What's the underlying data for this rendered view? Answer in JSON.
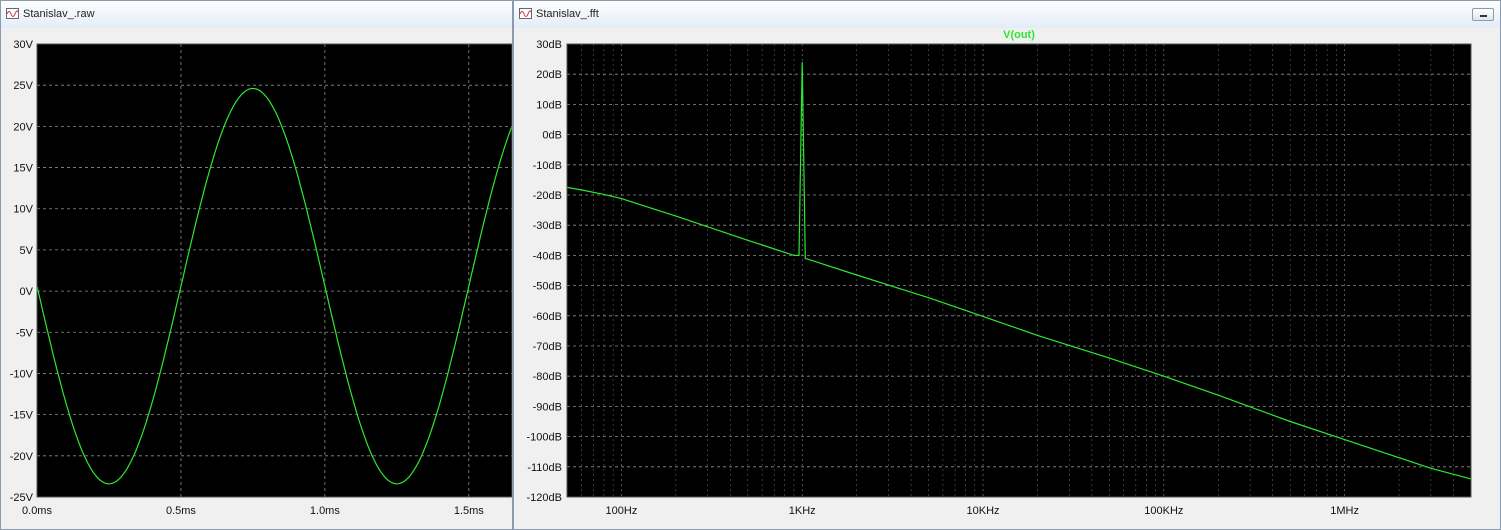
{
  "windows": {
    "raw": {
      "title": "Stanislav_.raw"
    },
    "fft": {
      "title": "Stanislav_.fft"
    }
  },
  "colors": {
    "trace": "#2ee82e",
    "title": "#2ee82e",
    "plot_bg": "#000000",
    "grid": "#8c8c8c"
  },
  "icons": {
    "app": "waveform-icon",
    "minimize": "minimize-icon"
  },
  "chart_data": [
    {
      "type": "line",
      "title": "",
      "xlabel": "",
      "ylabel": "",
      "xlim": [
        0.0,
        1.65
      ],
      "ylim": [
        -25,
        30
      ],
      "x_unit": "ms",
      "y_unit": "V",
      "xticks": [
        0.0,
        0.5,
        1.0,
        1.5
      ],
      "xtick_labels": [
        "0.0ms",
        "0.5ms",
        "1.0ms",
        "1.5ms"
      ],
      "yticks": [
        30,
        25,
        20,
        15,
        10,
        5,
        0,
        -5,
        -10,
        -15,
        -20,
        -25
      ],
      "ytick_labels": [
        "30V",
        "25V",
        "20V",
        "15V",
        "10V",
        "5V",
        "0V",
        "-5V",
        "-10V",
        "-15V",
        "-20V",
        "-25V"
      ],
      "grid": true,
      "series": [
        {
          "name": "",
          "amplitude": 24,
          "offset": 0.6,
          "frequency_hz": 1000,
          "phase": "inverted sine",
          "x": [
            0.0,
            0.25,
            0.5,
            0.75,
            1.0,
            1.25,
            1.5,
            1.65
          ],
          "y": [
            0.6,
            -23.4,
            0.6,
            24.6,
            0.6,
            -23.4,
            0.6,
            22.0
          ]
        }
      ]
    },
    {
      "type": "line",
      "title": "V(out)",
      "xlabel": "",
      "ylabel": "",
      "x_scale": "log",
      "xlim": [
        50,
        5000000
      ],
      "ylim": [
        -120,
        30
      ],
      "x_unit": "Hz",
      "y_unit": "dB",
      "xticks": [
        100,
        1000,
        10000,
        100000,
        1000000
      ],
      "xtick_labels": [
        "100Hz",
        "1KHz",
        "10KHz",
        "100KHz",
        "1MHz"
      ],
      "yticks": [
        30,
        20,
        10,
        0,
        -10,
        -20,
        -30,
        -40,
        -50,
        -60,
        -70,
        -80,
        -90,
        -100,
        -110,
        -120
      ],
      "ytick_labels": [
        "30dB",
        "20dB",
        "10dB",
        "0dB",
        "-10dB",
        "-20dB",
        "-30dB",
        "-40dB",
        "-50dB",
        "-60dB",
        "-70dB",
        "-80dB",
        "-90dB",
        "-100dB",
        "-110dB",
        "-120dB"
      ],
      "grid": true,
      "series": [
        {
          "name": "V(out)",
          "x": [
            50,
            60,
            80,
            100,
            200,
            500,
            900,
            960,
            1000,
            1040,
            1080,
            2000,
            5000,
            10000,
            20000,
            50000,
            100000,
            200000,
            500000,
            1000000,
            2000000,
            3000000,
            5000000
          ],
          "y": [
            -17.5,
            -18.3,
            -19.8,
            -21.2,
            -27,
            -35,
            -40,
            -40,
            24,
            -41,
            -41.3,
            -46.5,
            -54,
            -60.2,
            -66.5,
            -74,
            -80,
            -86.3,
            -95,
            -101,
            -107,
            -110.5,
            -114
          ]
        }
      ]
    }
  ]
}
